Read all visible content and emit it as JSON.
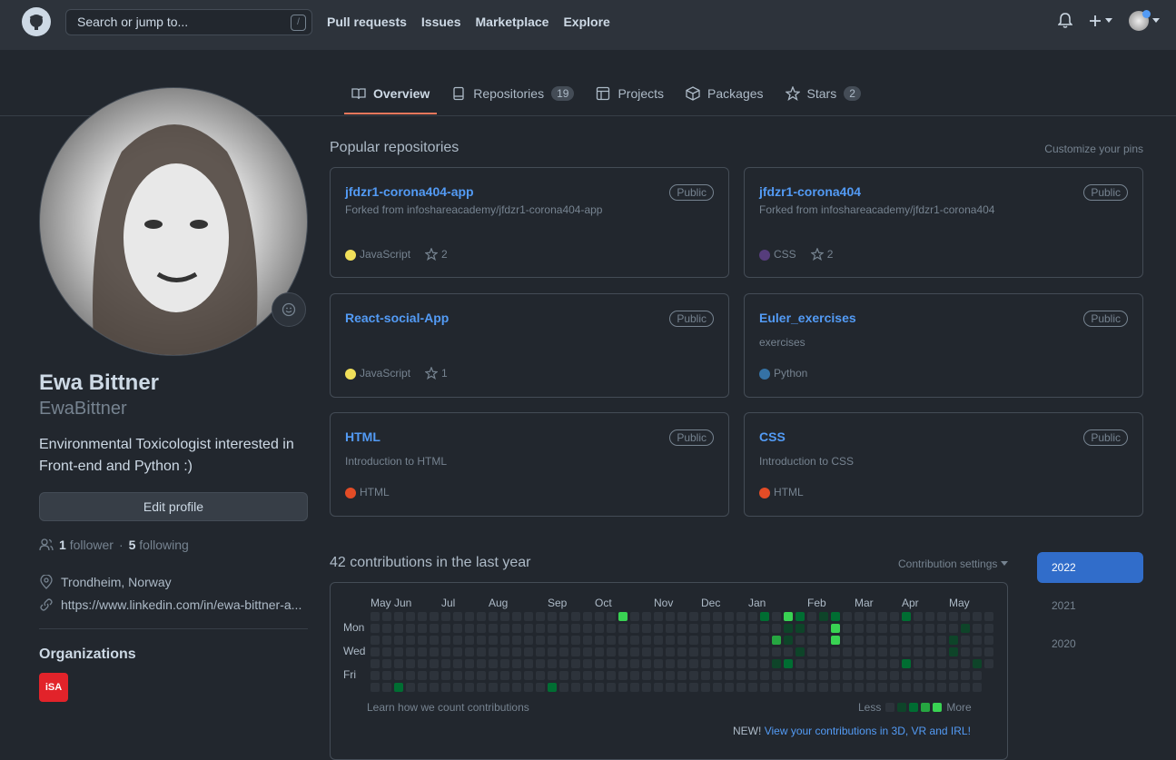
{
  "header": {
    "search_placeholder": "Search or jump to...",
    "slash_key": "/",
    "nav": [
      "Pull requests",
      "Issues",
      "Marketplace",
      "Explore"
    ]
  },
  "tabs": [
    {
      "label": "Overview",
      "count": null
    },
    {
      "label": "Repositories",
      "count": "19"
    },
    {
      "label": "Projects",
      "count": null
    },
    {
      "label": "Packages",
      "count": null
    },
    {
      "label": "Stars",
      "count": "2"
    }
  ],
  "profile": {
    "name": "Ewa Bittner",
    "login": "EwaBittner",
    "bio": "Environmental Toxicologist interested in Front-end and Python :)",
    "edit_label": "Edit profile",
    "followers_count": "1",
    "followers_label": "follower",
    "separator": "·",
    "following_count": "5",
    "following_label": "following",
    "location": "Trondheim, Norway",
    "website": "https://www.linkedin.com/in/ewa-bittner-a...",
    "orgs_heading": "Organizations",
    "org_logo_text": "iSA"
  },
  "popular": {
    "heading": "Popular repositories",
    "customize": "Customize your pins",
    "repos": [
      {
        "name": "jfdzr1-corona404-app",
        "visibility": "Public",
        "fork": "Forked from infoshareacademy/jfdzr1-corona404-app",
        "desc": "",
        "lang": "JavaScript",
        "lang_color": "#f1e05a",
        "stars": "2"
      },
      {
        "name": "jfdzr1-corona404",
        "visibility": "Public",
        "fork": "Forked from infoshareacademy/jfdzr1-corona404",
        "desc": "",
        "lang": "CSS",
        "lang_color": "#563d7c",
        "stars": "2"
      },
      {
        "name": "React-social-App",
        "visibility": "Public",
        "fork": "",
        "desc": "",
        "lang": "JavaScript",
        "lang_color": "#f1e05a",
        "stars": "1"
      },
      {
        "name": "Euler_exercises",
        "visibility": "Public",
        "fork": "",
        "desc": "exercises",
        "lang": "Python",
        "lang_color": "#3572A5",
        "stars": ""
      },
      {
        "name": "HTML",
        "visibility": "Public",
        "fork": "",
        "desc": "Introduction to HTML",
        "lang": "HTML",
        "lang_color": "#e34c26",
        "stars": ""
      },
      {
        "name": "CSS",
        "visibility": "Public",
        "fork": "",
        "desc": "Introduction to CSS",
        "lang": "HTML",
        "lang_color": "#e34c26",
        "stars": ""
      }
    ]
  },
  "contributions": {
    "heading": "42 contributions in the last year",
    "settings": "Contribution settings",
    "months": [
      "May",
      "Jun",
      "Jul",
      "Aug",
      "Sep",
      "Oct",
      "Nov",
      "Dec",
      "Jan",
      "Feb",
      "Mar",
      "Apr",
      "May"
    ],
    "days": [
      "Mon",
      "Wed",
      "Fri"
    ],
    "learn": "Learn how we count contributions",
    "less": "Less",
    "more": "More",
    "new_prefix": "NEW!",
    "new_link": "View your contributions in 3D, VR and IRL!",
    "years": [
      "2022",
      "2021",
      "2020"
    ],
    "active_year": "2022",
    "level_colors": [
      "#2d333b",
      "#0e4429",
      "#006d32",
      "#26a641",
      "#39d353"
    ],
    "activity": [
      {
        "week": 2,
        "day": 6,
        "level": 2
      },
      {
        "week": 15,
        "day": 6,
        "level": 2
      },
      {
        "week": 21,
        "day": 0,
        "level": 4
      },
      {
        "week": 33,
        "day": 0,
        "level": 2
      },
      {
        "week": 34,
        "day": 2,
        "level": 3
      },
      {
        "week": 34,
        "day": 4,
        "level": 1
      },
      {
        "week": 35,
        "day": 0,
        "level": 4
      },
      {
        "week": 35,
        "day": 1,
        "level": 1
      },
      {
        "week": 35,
        "day": 2,
        "level": 1
      },
      {
        "week": 35,
        "day": 4,
        "level": 2
      },
      {
        "week": 36,
        "day": 0,
        "level": 2
      },
      {
        "week": 36,
        "day": 1,
        "level": 1
      },
      {
        "week": 36,
        "day": 3,
        "level": 1
      },
      {
        "week": 38,
        "day": 0,
        "level": 1
      },
      {
        "week": 39,
        "day": 0,
        "level": 2
      },
      {
        "week": 39,
        "day": 1,
        "level": 4
      },
      {
        "week": 39,
        "day": 2,
        "level": 4
      },
      {
        "week": 45,
        "day": 0,
        "level": 2
      },
      {
        "week": 45,
        "day": 4,
        "level": 2
      },
      {
        "week": 50,
        "day": 1,
        "level": 1
      },
      {
        "week": 49,
        "day": 2,
        "level": 1
      },
      {
        "week": 49,
        "day": 3,
        "level": 1
      },
      {
        "week": 51,
        "day": 4,
        "level": 1
      }
    ]
  }
}
